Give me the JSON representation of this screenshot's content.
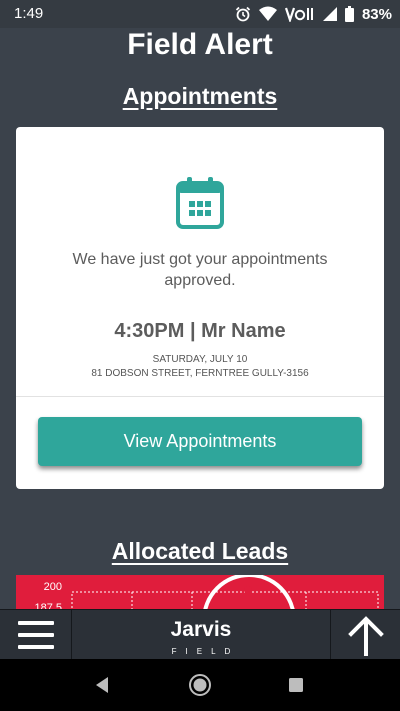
{
  "status": {
    "time": "1:49",
    "battery": "83%"
  },
  "page": {
    "title": "Field Alert"
  },
  "appointments": {
    "heading": "Appointments",
    "message": "We have just got your appointments approved.",
    "time_line": "4:30PM | Mr Name",
    "date": "SATURDAY, JULY 10",
    "address": "81 DOBSON STREET, FERNTREE GULLY-3156",
    "button_label": "View Appointments",
    "accent_color": "#2fa69b",
    "icon": "calendar-icon"
  },
  "leads": {
    "heading": "Allocated Leads",
    "panel_color": "#e01d3c",
    "y_ticks": [
      "200",
      "187.5"
    ]
  },
  "bottom_bar": {
    "brand_name": "Jarvis",
    "brand_sub": "FIELD",
    "menu_icon": "hamburger-menu-icon",
    "up_icon": "arrow-up-icon"
  },
  "nav": {
    "back_icon": "back-triangle-icon",
    "home_icon": "home-circle-icon",
    "recent_icon": "recent-apps-square-icon"
  }
}
